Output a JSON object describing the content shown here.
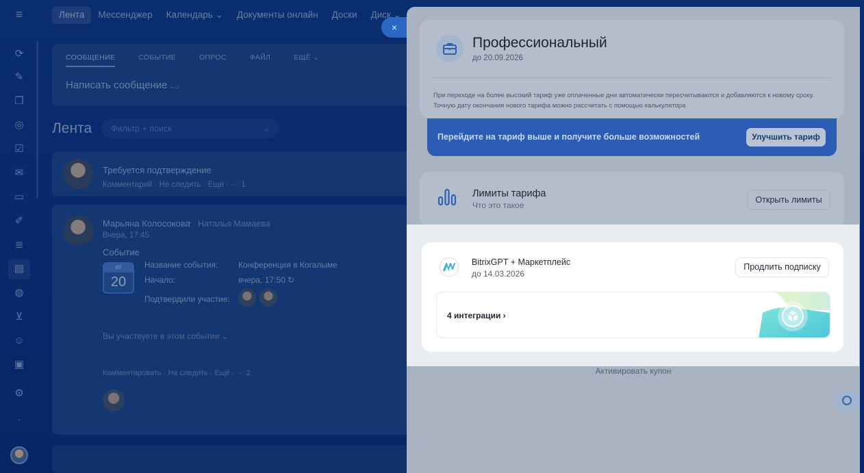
{
  "nav": {
    "items": [
      "Лента",
      "Мессенджер",
      "Календарь",
      "Документы онлайн",
      "Доски",
      "Диск"
    ],
    "chevron": "⌄"
  },
  "composer": {
    "tabs": [
      "СООБЩЕНИЕ",
      "СОБЫТИЕ",
      "ОПРОС",
      "ФАЙЛ",
      "ЕЩЁ ⌄"
    ],
    "placeholder": "Написать сообщение ..."
  },
  "feed": {
    "title": "Лента",
    "filter_placeholder": "Фильтр + поиск",
    "post1": {
      "title": "Требуется подтверждение",
      "meta": "Комментарий · Не следить · Ещё · ··· 1"
    },
    "post2": {
      "author": "Марьяна Колосокова",
      "arrow": "›",
      "recipient": "Наталья Мамаева",
      "time": "Вчера, 17:45",
      "type": "Событие",
      "cal_month": "ВТ",
      "cal_day": "20",
      "event_name_label": "Название события:",
      "event_name": "Конференция в Когалыме",
      "start_label": "Начало:",
      "start_value": "вчера, 17:50 ↻",
      "confirmed_label": "Подтвердили участие:",
      "participate": "Вы участвуете в этом событии ⌄",
      "comment_meta": "Комментировать · Не следить · Ещё · ··· 2"
    }
  },
  "panel": {
    "close": "×",
    "tariff": {
      "name": "Профессиональный",
      "until": "до 20.09.2026",
      "note": "При переходе на более высокий тариф уже оплаченные дни автоматически пересчитываются и добавляются к новому сроку. Точную дату окончания нового тарифа можно рассчитать с помощью калькулятора"
    },
    "upgrade": {
      "text": "Перейдите на тариф выше и получите больше возможностей",
      "button": "Улучшить тариф"
    },
    "limits": {
      "title": "Лимиты тарифа",
      "subtitle": "Что это такое",
      "button": "Открыть лимиты"
    },
    "subscription": {
      "name": "BitrixGPT + Маркетплейс",
      "until": "до 14.03.2026",
      "button": "Продлить подписку",
      "integrations": "4 интеграции",
      "integrations_chevron": "›"
    },
    "coupon": "Активировать купон"
  },
  "colors": {
    "accent_blue": "#2b5db4",
    "app_bg": "#0d3a8a",
    "highlight_bg": "#e9ecf1"
  }
}
